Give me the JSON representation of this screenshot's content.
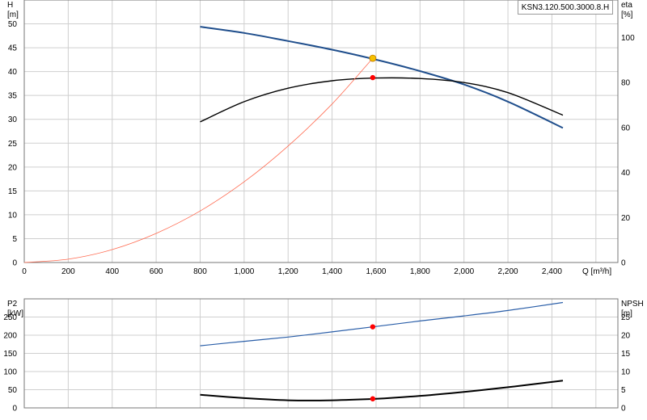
{
  "model_label": "KSN3.120.500.3000.8.H",
  "colors": {
    "head_curve": "#1f4e8c",
    "eta_curve": "#000000",
    "system_curve": "#ff6a50",
    "p2_curve": "#2a5ea8",
    "npsh_curve": "#000000",
    "duty_point": "#ff0000",
    "duty_intersection": "#f5c000",
    "grid": "#cfcfcf"
  },
  "chart_data": [
    {
      "type": "line",
      "ylabel": "H",
      "yunit": "[m]",
      "y2label": "eta",
      "y2unit": "[%]",
      "xlabel": "Q [m³/h]",
      "xlim": [
        0,
        2700
      ],
      "ylim": [
        0,
        55
      ],
      "y2lim": [
        0,
        116.7
      ],
      "grid": true,
      "x_ticks": [
        "0",
        "200",
        "400",
        "600",
        "800",
        "1,000",
        "1,200",
        "1,400",
        "1,600",
        "1,800",
        "2,000",
        "2,200",
        "2,400"
      ],
      "y_ticks": [
        "0",
        "5",
        "10",
        "15",
        "20",
        "25",
        "30",
        "35",
        "40",
        "45",
        "50"
      ],
      "y2_ticks": [
        "0",
        "20",
        "40",
        "60",
        "80",
        "100"
      ],
      "series": [
        {
          "key": "H",
          "axis": "y",
          "x": [
            800,
            1000,
            1200,
            1400,
            1600,
            1800,
            2000,
            2200,
            2450
          ],
          "y": [
            49.4,
            48.1,
            46.4,
            44.6,
            42.5,
            40.1,
            37.3,
            33.7,
            28.2
          ]
        },
        {
          "key": "eta",
          "axis": "y2",
          "x": [
            800,
            1000,
            1200,
            1400,
            1600,
            1800,
            2000,
            2200,
            2450
          ],
          "y": [
            62.5,
            71.5,
            77.5,
            80.8,
            82,
            81.8,
            80,
            75.5,
            65.5
          ]
        },
        {
          "key": "system",
          "axis": "y",
          "x": [
            0,
            200,
            400,
            600,
            800,
            1000,
            1200,
            1400,
            1585
          ],
          "y": [
            0,
            0.7,
            2.7,
            6.1,
            10.8,
            16.9,
            24.4,
            33.2,
            42.8
          ]
        }
      ],
      "points": [
        {
          "key": "duty_H",
          "axis": "y",
          "x": 1585,
          "y": 42.8,
          "color": "#f5c000"
        },
        {
          "key": "duty_eta",
          "axis": "y2",
          "x": 1585,
          "y": 82.2,
          "color": "#ff0000"
        }
      ]
    },
    {
      "type": "line",
      "ylabel": "P2",
      "yunit": "[kW]",
      "y2label": "NPSH",
      "y2unit": "[m]",
      "xlim": [
        0,
        2700
      ],
      "ylim": [
        0,
        300
      ],
      "y2lim": [
        0,
        30
      ],
      "grid": true,
      "y_ticks": [
        "0",
        "50",
        "100",
        "150",
        "200",
        "250"
      ],
      "y2_ticks": [
        "0",
        "5",
        "10",
        "15",
        "20",
        "25"
      ],
      "series": [
        {
          "key": "P2",
          "axis": "y",
          "x": [
            800,
            1000,
            1200,
            1400,
            1600,
            1800,
            2000,
            2200,
            2450
          ],
          "y": [
            171,
            183,
            195,
            209,
            224,
            239,
            253,
            268,
            290
          ]
        },
        {
          "key": "NPSH",
          "axis": "y2",
          "x": [
            800,
            1000,
            1200,
            1400,
            1600,
            1800,
            2000,
            2200,
            2450
          ],
          "y": [
            3.6,
            2.7,
            2.1,
            2.1,
            2.5,
            3.3,
            4.4,
            5.7,
            7.5
          ]
        }
      ],
      "points": [
        {
          "key": "duty_P2",
          "axis": "y",
          "x": 1585,
          "y": 223,
          "color": "#ff0000"
        },
        {
          "key": "duty_NPSH",
          "axis": "y2",
          "x": 1585,
          "y": 2.5,
          "color": "#ff0000"
        }
      ]
    }
  ]
}
